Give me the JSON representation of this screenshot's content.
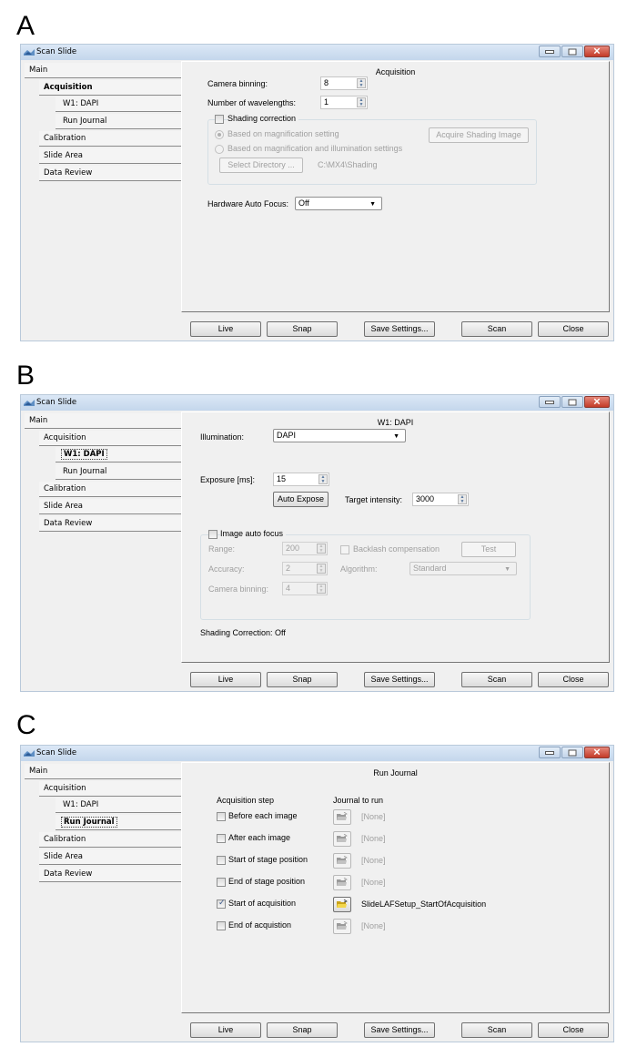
{
  "panels": {
    "a": {
      "letter": "A",
      "window_title": "Scan Slide",
      "nav": {
        "main": "Main",
        "acquisition": "Acquisition",
        "w1_dapi": "W1: DAPI",
        "run_journal": "Run Journal",
        "calibration": "Calibration",
        "slide_area": "Slide Area",
        "data_review": "Data Review",
        "selected": "Acquisition"
      },
      "content": {
        "title": "Acquisition",
        "camera_binning_label": "Camera binning:",
        "camera_binning_value": "8",
        "num_wavelengths_label": "Number of wavelengths:",
        "num_wavelengths_value": "1",
        "shading_correction_label": "Shading correction",
        "shading_correction_checked": false,
        "radio_magnification": "Based on magnification setting",
        "radio_magnification_illumination": "Based on magnification and illumination settings",
        "acquire_shading_image": "Acquire Shading Image",
        "select_directory": "Select Directory ...",
        "shading_path": "C:\\MX4\\Shading",
        "hardware_auto_focus_label": "Hardware Auto Focus:",
        "hardware_auto_focus_value": "Off"
      }
    },
    "b": {
      "letter": "B",
      "window_title": "Scan Slide",
      "nav": {
        "main": "Main",
        "acquisition": "Acquisition",
        "w1_dapi": "W1: DAPI",
        "run_journal": "Run Journal",
        "calibration": "Calibration",
        "slide_area": "Slide Area",
        "data_review": "Data Review",
        "selected": "W1: DAPI"
      },
      "content": {
        "title": "W1: DAPI",
        "illumination_label": "Illumination:",
        "illumination_value": "DAPI",
        "exposure_label": "Exposure [ms]:",
        "exposure_value": "15",
        "auto_expose": "Auto Expose",
        "target_intensity_label": "Target intensity:",
        "target_intensity_value": "3000",
        "image_auto_focus_label": "Image auto focus",
        "image_auto_focus_checked": false,
        "range_label": "Range:",
        "range_value": "200",
        "accuracy_label": "Accuracy:",
        "accuracy_value": "2",
        "af_camera_binning_label": "Camera binning:",
        "af_camera_binning_value": "4",
        "backlash_label": "Backlash compensation",
        "backlash_checked": false,
        "test_button": "Test",
        "algorithm_label": "Algorithm:",
        "algorithm_value": "Standard",
        "shading_status": "Shading Correction: Off"
      }
    },
    "c": {
      "letter": "C",
      "window_title": "Scan Slide",
      "nav": {
        "main": "Main",
        "acquisition": "Acquisition",
        "w1_dapi": "W1: DAPI",
        "run_journal": "Run Journal",
        "calibration": "Calibration",
        "slide_area": "Slide Area",
        "data_review": "Data Review",
        "selected": "Run Journal"
      },
      "content": {
        "title": "Run Journal",
        "col_step": "Acquisition step",
        "col_journal": "Journal to run",
        "rows": [
          {
            "step": "Before each image",
            "checked": false,
            "journal": "[None]"
          },
          {
            "step": "After each image",
            "checked": false,
            "journal": "[None]"
          },
          {
            "step": "Start of stage position",
            "checked": false,
            "journal": "[None]"
          },
          {
            "step": "End of stage position",
            "checked": false,
            "journal": "[None]"
          },
          {
            "step": "Start of acquisition",
            "checked": true,
            "journal": "SlideLAFSetup_StartOfAcquisition"
          },
          {
            "step": "End of acquistion",
            "checked": false,
            "journal": "[None]"
          }
        ]
      }
    }
  },
  "buttons": {
    "live": "Live",
    "snap": "Snap",
    "save_settings": "Save Settings...",
    "scan": "Scan",
    "close": "Close"
  },
  "colors": {
    "titlebar": "#c9dbef",
    "close_button": "#c94a3a",
    "window_bg": "#f0f0f0",
    "disabled_text": "#a0a0a0"
  }
}
